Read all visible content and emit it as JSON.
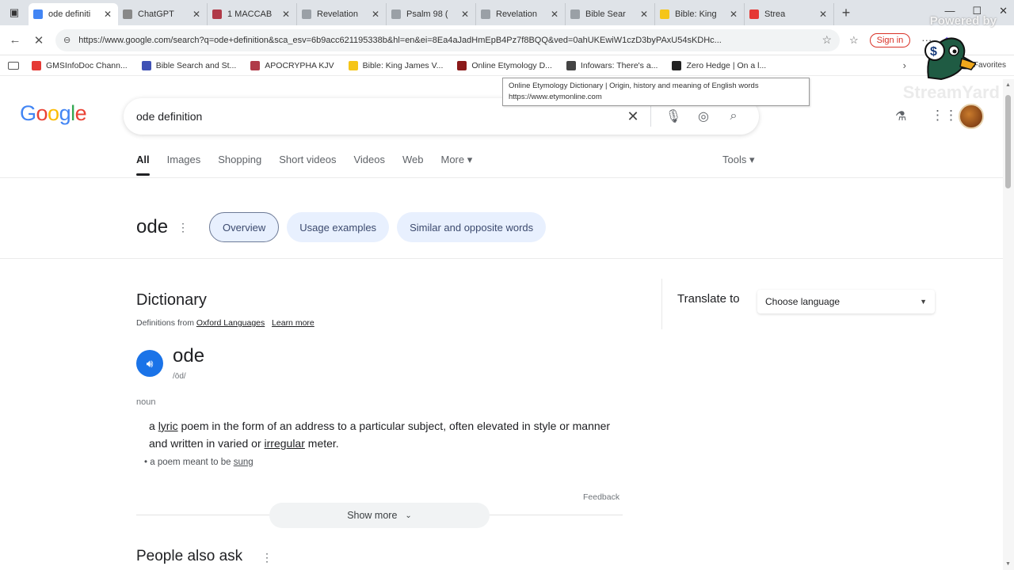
{
  "browser": {
    "tabs": [
      {
        "label": "ode definiti",
        "color": "#4285f4",
        "active": true
      },
      {
        "label": "ChatGPT",
        "color": "#888888"
      },
      {
        "label": "1 MACCAB",
        "color": "#b03a48"
      },
      {
        "label": "Revelation",
        "color": "#9aa0a6"
      },
      {
        "label": "Psalm 98 (",
        "color": "#9aa0a6"
      },
      {
        "label": "Revelation",
        "color": "#9aa0a6"
      },
      {
        "label": "Bible Sear",
        "color": "#9aa0a6"
      },
      {
        "label": "Bible: King",
        "color": "#f5c518"
      },
      {
        "label": "Strea",
        "color": "#e53935"
      }
    ],
    "new_tab_glyph": "+",
    "url": "https://www.google.com/search?q=ode+definition&sca_esv=6b9acc621195338b&hl=en&ei=8Ea4aJadHmEpB4Pz7f8BQQ&ved=0ahUKEwiW1czD3byPAxU54sKDHc...",
    "sign_in_label": "Sign in",
    "bookmarks": [
      {
        "label": "GMSInfoDoc Chann...",
        "color": "#e53935"
      },
      {
        "label": "Bible Search and St...",
        "color": "#3f51b5"
      },
      {
        "label": "APOCRYPHA KJV",
        "color": "#b03a48"
      },
      {
        "label": "Bible: King James V...",
        "color": "#f5c518"
      },
      {
        "label": "Online Etymology D...",
        "color": "#8b1a1a"
      },
      {
        "label": "Infowars: There's a...",
        "color": "#444444"
      },
      {
        "label": "Zero Hedge | On a l...",
        "color": "#222222"
      }
    ],
    "bookmarks_more": "›",
    "favorites_label": "Favorites",
    "tooltip": {
      "title": "Online Etymology Dictionary | Origin, history and meaning of English words",
      "url": "https://www.etymonline.com"
    }
  },
  "overlay": {
    "powered_by": "Powered by",
    "brand": "StreamYard"
  },
  "google": {
    "logo_letters": [
      {
        "ch": "G",
        "color": "#4285f4"
      },
      {
        "ch": "o",
        "color": "#ea4335"
      },
      {
        "ch": "o",
        "color": "#fbbc05"
      },
      {
        "ch": "g",
        "color": "#4285f4"
      },
      {
        "ch": "l",
        "color": "#34a853"
      },
      {
        "ch": "e",
        "color": "#ea4335"
      }
    ],
    "query": "ode definition",
    "tabs": [
      "All",
      "Images",
      "Shopping",
      "Short videos",
      "Videos",
      "Web",
      "More ▾"
    ],
    "tools": "Tools ▾",
    "term": "ode",
    "chips": [
      "Overview",
      "Usage examples",
      "Similar and opposite words"
    ],
    "dictionary": {
      "title": "Dictionary",
      "source_prefix": "Definitions from",
      "source_link": "Oxford Languages",
      "learn_more": "Learn more",
      "headword": "ode",
      "pronunciation": "/ōd/",
      "pos": "noun",
      "definition_parts": [
        {
          "t": "a ",
          "u": false
        },
        {
          "t": "lyric",
          "u": true
        },
        {
          "t": " poem in the form of an address to a particular subject, often elevated in style or manner and written in varied or ",
          "u": false
        },
        {
          "t": "irregular",
          "u": true
        },
        {
          "t": " meter.",
          "u": false
        }
      ],
      "subdef_prefix": "a poem meant to be ",
      "subdef_link": "sung",
      "feedback": "Feedback",
      "show_more": "Show more"
    },
    "people_also_ask": "People also ask",
    "translate": {
      "label": "Translate to",
      "select_value": "Choose language"
    }
  }
}
